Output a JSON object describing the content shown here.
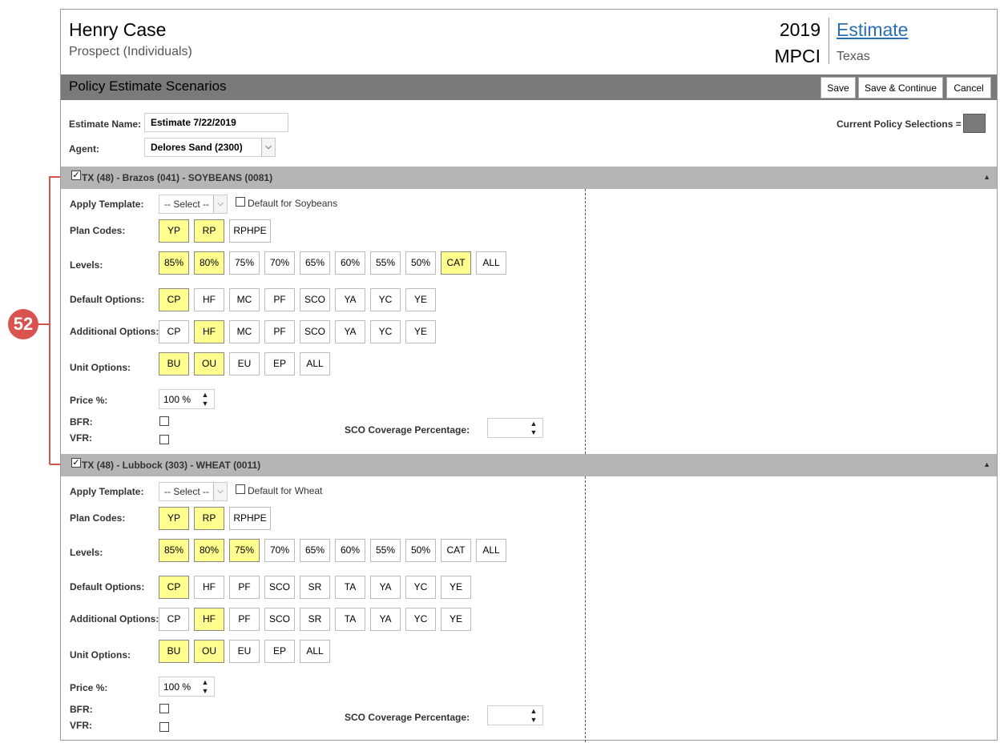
{
  "header": {
    "client_name": "Henry Case",
    "client_type": "Prospect (Individuals)",
    "year": "2019",
    "product": "MPCI",
    "estimate_link": "Estimate",
    "state": "Texas"
  },
  "titlebar": {
    "title": "Policy Estimate Scenarios",
    "save": "Save",
    "save_continue": "Save & Continue",
    "cancel": "Cancel"
  },
  "form": {
    "estimate_name_label": "Estimate Name:",
    "estimate_name_value": "Estimate 7/22/2019",
    "agent_label": "Agent:",
    "agent_value": "Delores Sand (2300)",
    "current_policy_label": "Current Policy Selections ="
  },
  "labels": {
    "apply_template": "Apply Template:",
    "select_placeholder": "-- Select --",
    "plan_codes": "Plan Codes:",
    "levels": "Levels:",
    "default_options": "Default Options:",
    "additional_options": "Additional Options:",
    "unit_options": "Unit Options:",
    "price_pct": "Price %:",
    "bfr": "BFR:",
    "vfr": "VFR:",
    "sco_coverage": "SCO Coverage Percentage:",
    "price_value": "100 %"
  },
  "annotation": {
    "badge": "52"
  },
  "sections": [
    {
      "title": "TX (48) - Brazos (041) - SOYBEANS (0081)",
      "checked": true,
      "default_for": "Default for Soybeans",
      "plan_codes": [
        {
          "label": "YP",
          "sel": true
        },
        {
          "label": "RP",
          "sel": true
        },
        {
          "label": "RPHPE",
          "sel": false
        }
      ],
      "levels": [
        {
          "label": "85%",
          "sel": true
        },
        {
          "label": "80%",
          "sel": true
        },
        {
          "label": "75%",
          "sel": false
        },
        {
          "label": "70%",
          "sel": false
        },
        {
          "label": "65%",
          "sel": false
        },
        {
          "label": "60%",
          "sel": false
        },
        {
          "label": "55%",
          "sel": false
        },
        {
          "label": "50%",
          "sel": false
        },
        {
          "label": "CAT",
          "sel": true
        },
        {
          "label": "ALL",
          "sel": false
        }
      ],
      "default_options": [
        {
          "label": "CP",
          "sel": true
        },
        {
          "label": "HF",
          "sel": false
        },
        {
          "label": "MC",
          "sel": false
        },
        {
          "label": "PF",
          "sel": false
        },
        {
          "label": "SCO",
          "sel": false
        },
        {
          "label": "YA",
          "sel": false
        },
        {
          "label": "YC",
          "sel": false
        },
        {
          "label": "YE",
          "sel": false
        }
      ],
      "additional_options": [
        {
          "label": "CP",
          "sel": false
        },
        {
          "label": "HF",
          "sel": true
        },
        {
          "label": "MC",
          "sel": false
        },
        {
          "label": "PF",
          "sel": false
        },
        {
          "label": "SCO",
          "sel": false
        },
        {
          "label": "YA",
          "sel": false
        },
        {
          "label": "YC",
          "sel": false
        },
        {
          "label": "YE",
          "sel": false
        }
      ],
      "unit_options": [
        {
          "label": "BU",
          "sel": true
        },
        {
          "label": "OU",
          "sel": true
        },
        {
          "label": "EU",
          "sel": false
        },
        {
          "label": "EP",
          "sel": false
        },
        {
          "label": "ALL",
          "sel": false
        }
      ]
    },
    {
      "title": "TX (48) - Lubbock (303) - WHEAT (0011)",
      "checked": true,
      "default_for": "Default for Wheat",
      "plan_codes": [
        {
          "label": "YP",
          "sel": true
        },
        {
          "label": "RP",
          "sel": true
        },
        {
          "label": "RPHPE",
          "sel": false
        }
      ],
      "levels": [
        {
          "label": "85%",
          "sel": true
        },
        {
          "label": "80%",
          "sel": true
        },
        {
          "label": "75%",
          "sel": true
        },
        {
          "label": "70%",
          "sel": false
        },
        {
          "label": "65%",
          "sel": false
        },
        {
          "label": "60%",
          "sel": false
        },
        {
          "label": "55%",
          "sel": false
        },
        {
          "label": "50%",
          "sel": false
        },
        {
          "label": "CAT",
          "sel": false
        },
        {
          "label": "ALL",
          "sel": false
        }
      ],
      "default_options": [
        {
          "label": "CP",
          "sel": true
        },
        {
          "label": "HF",
          "sel": false
        },
        {
          "label": "PF",
          "sel": false
        },
        {
          "label": "SCO",
          "sel": false
        },
        {
          "label": "SR",
          "sel": false
        },
        {
          "label": "TA",
          "sel": false
        },
        {
          "label": "YA",
          "sel": false
        },
        {
          "label": "YC",
          "sel": false
        },
        {
          "label": "YE",
          "sel": false
        }
      ],
      "additional_options": [
        {
          "label": "CP",
          "sel": false
        },
        {
          "label": "HF",
          "sel": true
        },
        {
          "label": "PF",
          "sel": false
        },
        {
          "label": "SCO",
          "sel": false
        },
        {
          "label": "SR",
          "sel": false
        },
        {
          "label": "TA",
          "sel": false
        },
        {
          "label": "YA",
          "sel": false
        },
        {
          "label": "YC",
          "sel": false
        },
        {
          "label": "YE",
          "sel": false
        }
      ],
      "unit_options": [
        {
          "label": "BU",
          "sel": true
        },
        {
          "label": "OU",
          "sel": true
        },
        {
          "label": "EU",
          "sel": false
        },
        {
          "label": "EP",
          "sel": false
        },
        {
          "label": "ALL",
          "sel": false
        }
      ]
    }
  ]
}
